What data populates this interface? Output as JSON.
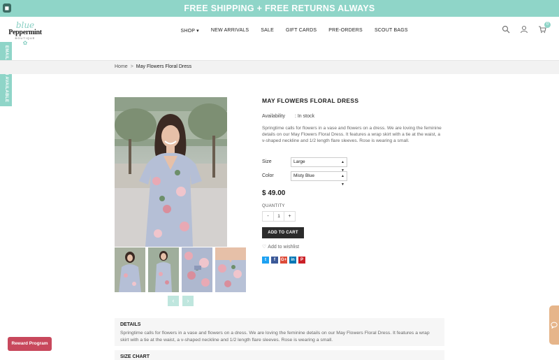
{
  "announcement": {
    "text": "FREE SHIPPING + FREE RETURNS ALWAYS"
  },
  "logo": {
    "line1": "blue",
    "line2": "Peppermint",
    "line3": "BOUTIQUE"
  },
  "nav": [
    {
      "label": "SHOP ▾"
    },
    {
      "label": "NEW ARRIVALS"
    },
    {
      "label": "SALE"
    },
    {
      "label": "GIFT CARDS"
    },
    {
      "label": "PRE-ORDERS"
    },
    {
      "label": "SCOUT BAGS"
    }
  ],
  "header_icons": {
    "search": "search-icon",
    "account": "user-icon",
    "cart": "cart-icon",
    "cart_count": "0"
  },
  "side_tab": {
    "label": "EMAIL WHEN AVAILABLE"
  },
  "breadcrumb": {
    "home": "Home",
    "separator": ">",
    "current": "May Flowers Floral Dress"
  },
  "product": {
    "title": "MAY FLOWERS FLORAL DRESS",
    "availability_label": "Availability",
    "availability_value": ": In stock",
    "description": "Springtime calls for flowers in a vase and flowers on a dress. We are loving the feminine details on our May Flowers Floral Dress. It features a wrap skirt with a tie at the waist, a v-shaped neckline and 1/2 length flare sleeves. Rose is wearing a small.",
    "size_label": "Size",
    "size_value": "Large",
    "color_label": "Color",
    "color_value": "Misty Blue",
    "price": "$ 49.00",
    "quantity_label": "QUANTITY",
    "quantity_minus": "-",
    "quantity_value": "1",
    "quantity_plus": "+",
    "add_to_cart": "ADD TO CART",
    "wishlist": "Add to wishlist"
  },
  "thumb_nav": {
    "prev": "‹",
    "next": "›"
  },
  "share": [
    {
      "name": "twitter",
      "glyph": "t",
      "color": "#1da1f2"
    },
    {
      "name": "facebook",
      "glyph": "f",
      "color": "#3b5998"
    },
    {
      "name": "google-plus",
      "glyph": "G+",
      "color": "#dd4b39"
    },
    {
      "name": "linkedin",
      "glyph": "in",
      "color": "#0077b5"
    },
    {
      "name": "pinterest",
      "glyph": "P",
      "color": "#cb2027"
    }
  ],
  "details": {
    "heading": "DETAILS",
    "text": "Springtime calls for flowers in a vase and flowers on a dress. We are loving the feminine details on our May Flowers Floral Dress. It features a wrap skirt with a tie at the waist, a v-shaped neckline and 1/2 length flare sleeves. Rose is wearing a small."
  },
  "size_chart": {
    "heading": "SIZE CHART"
  },
  "reward": {
    "label": "Reward Program"
  },
  "colors": {
    "accent": "#8fd5c8",
    "reward": "#c8485c",
    "chat": "#e6b58a"
  }
}
